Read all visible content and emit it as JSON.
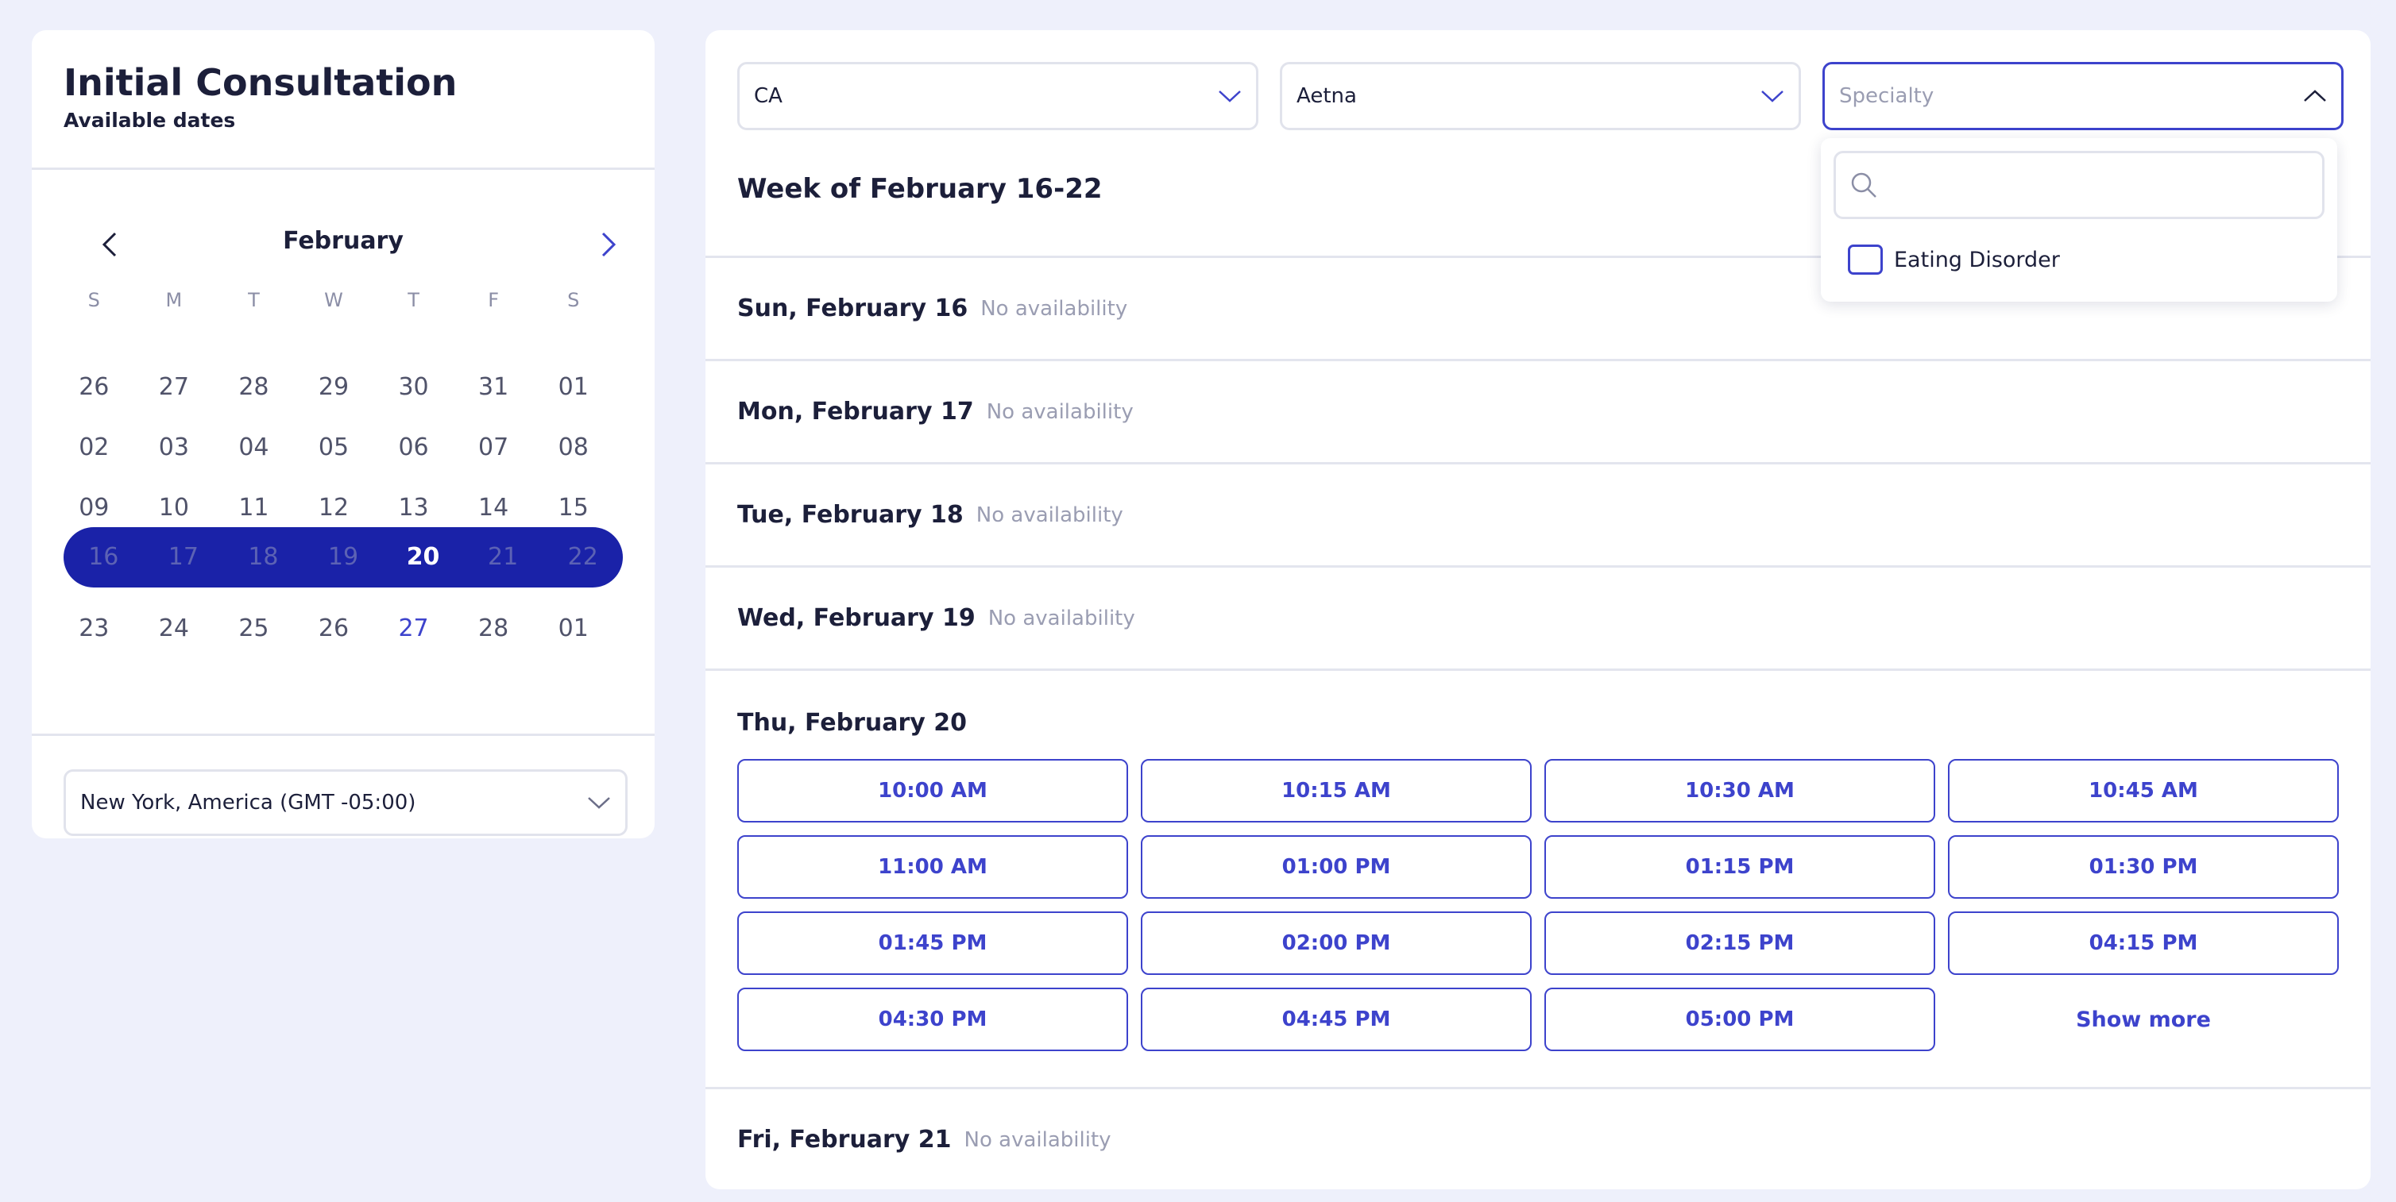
{
  "consultation": {
    "title": "Initial Consultation",
    "subtitle": "Available dates"
  },
  "calendar": {
    "month": "February",
    "weekday_headers": [
      "S",
      "M",
      "T",
      "W",
      "T",
      "F",
      "S"
    ],
    "weeks": [
      [
        "26",
        "27",
        "28",
        "29",
        "30",
        "31",
        "01"
      ],
      [
        "02",
        "03",
        "04",
        "05",
        "06",
        "07",
        "08"
      ],
      [
        "09",
        "10",
        "11",
        "12",
        "13",
        "14",
        "15"
      ],
      [
        "16",
        "17",
        "18",
        "19",
        "20",
        "21",
        "22"
      ],
      [
        "23",
        "24",
        "25",
        "26",
        "27",
        "28",
        "01"
      ]
    ],
    "selected_week_index": 3,
    "today": "20",
    "highlighted": "27"
  },
  "timezone": {
    "value": "New York, America (GMT -05:00)"
  },
  "filters": {
    "state": "CA",
    "insurance": "Aetna",
    "specialty_placeholder": "Specialty"
  },
  "specialty_dropdown": {
    "search_placeholder": "",
    "options": [
      {
        "label": "Eating Disorder",
        "checked": false
      }
    ]
  },
  "schedule": {
    "week_heading": "Week of February 16-22",
    "no_availability_text": "No availability",
    "days": [
      {
        "name": "Sun, February 16",
        "available": false
      },
      {
        "name": "Mon, February 17",
        "available": false
      },
      {
        "name": "Tue, February 18",
        "available": false
      },
      {
        "name": "Wed, February 19",
        "available": false
      },
      {
        "name": "Thu, February 20",
        "available": true
      },
      {
        "name": "Fri, February 21",
        "available": false
      }
    ],
    "thursday_slots": [
      "10:00 AM",
      "10:15 AM",
      "10:30 AM",
      "10:45 AM",
      "11:00 AM",
      "01:00 PM",
      "01:15 PM",
      "01:30 PM",
      "01:45 PM",
      "02:00 PM",
      "02:15 PM",
      "04:15 PM",
      "04:30 PM",
      "04:45 PM",
      "05:00 PM"
    ],
    "show_more_label": "Show more"
  },
  "colors": {
    "accent": "#3d43cc",
    "selected_week": "#1a22a8",
    "page_background": "#eef0fb"
  },
  "icons": {
    "prev": "chevron-left-icon",
    "next": "chevron-right-icon",
    "dropdown": "chevron-down-icon",
    "dropdown_open": "chevron-up-icon",
    "search": "search-icon"
  }
}
